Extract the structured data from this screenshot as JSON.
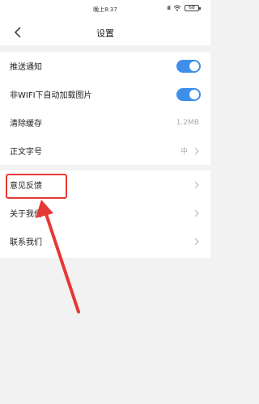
{
  "status_bar": {
    "time": "晚上8:37",
    "signal": "ılıl",
    "battery": "68"
  },
  "header": {
    "title": "设置"
  },
  "settings": {
    "group1": [
      {
        "label": "推送通知",
        "control": "toggle",
        "on": true
      },
      {
        "label": "非WIFI下自动加载图片",
        "control": "toggle",
        "on": true
      },
      {
        "label": "清除缓存",
        "control": "value",
        "value": "1.2MB"
      },
      {
        "label": "正文字号",
        "control": "value-chevron",
        "value": "中"
      }
    ],
    "group2": [
      {
        "label": "意见反馈"
      },
      {
        "label": "关于我们"
      },
      {
        "label": "联系我们"
      }
    ]
  },
  "colors": {
    "toggle_on": "#3d8fea",
    "annotation": "#e53935",
    "background": "#f2f2f2"
  }
}
